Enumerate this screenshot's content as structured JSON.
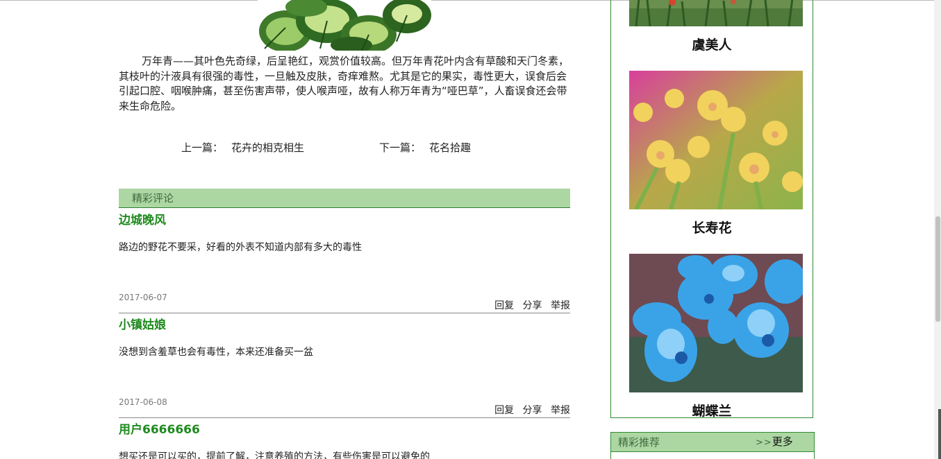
{
  "article": {
    "paragraph": "万年青——其叶色先奇绿，后呈艳红，观赏价值较高。但万年青花叶内含有草酸和天门冬素，其枝叶的汁液具有很强的毒性，一旦触及皮肤，奇痒难熬。尤其是它的果实，毒性更大，误食后会引起口腔、咽喉肿痛，甚至伤害声带，使人喉声哑，故有人称万年青为“哑巴草”，人畜误食还会带来生命危险。"
  },
  "nav": {
    "prev_label": "上一篇：",
    "prev_title": "花卉的相克相生",
    "next_label": "下一篇：",
    "next_title": "花名拾趣"
  },
  "comments_section": {
    "title": "精彩评论",
    "items": [
      {
        "author": "边城晚风",
        "text": "路边的野花不要采，好看的外表不知道内部有多大的毒性",
        "date": "2017-06-07"
      },
      {
        "author": "小镇姑娘",
        "text": "没想到含羞草也会有毒性，本来还准备买一盆",
        "date": "2017-06-08"
      },
      {
        "author": "用户6666666",
        "text": "想买还是可以买的，提前了解，注意养殖的方法，有些伤害是可以避免的",
        "date": ""
      }
    ],
    "actions": {
      "reply": "回复",
      "share": "分享",
      "report": "举报"
    }
  },
  "sidebar": {
    "flowers": [
      {
        "name": "虞美人"
      },
      {
        "name": "长寿花"
      },
      {
        "name": "蝴蝶兰"
      }
    ]
  },
  "recommend": {
    "title": "精彩推荐",
    "more_arrows": ">>",
    "more_label": "更多"
  },
  "colors": {
    "header_green": "#acd7a3",
    "author_green": "#1e8a1e",
    "border_green": "#2f8a2f"
  }
}
